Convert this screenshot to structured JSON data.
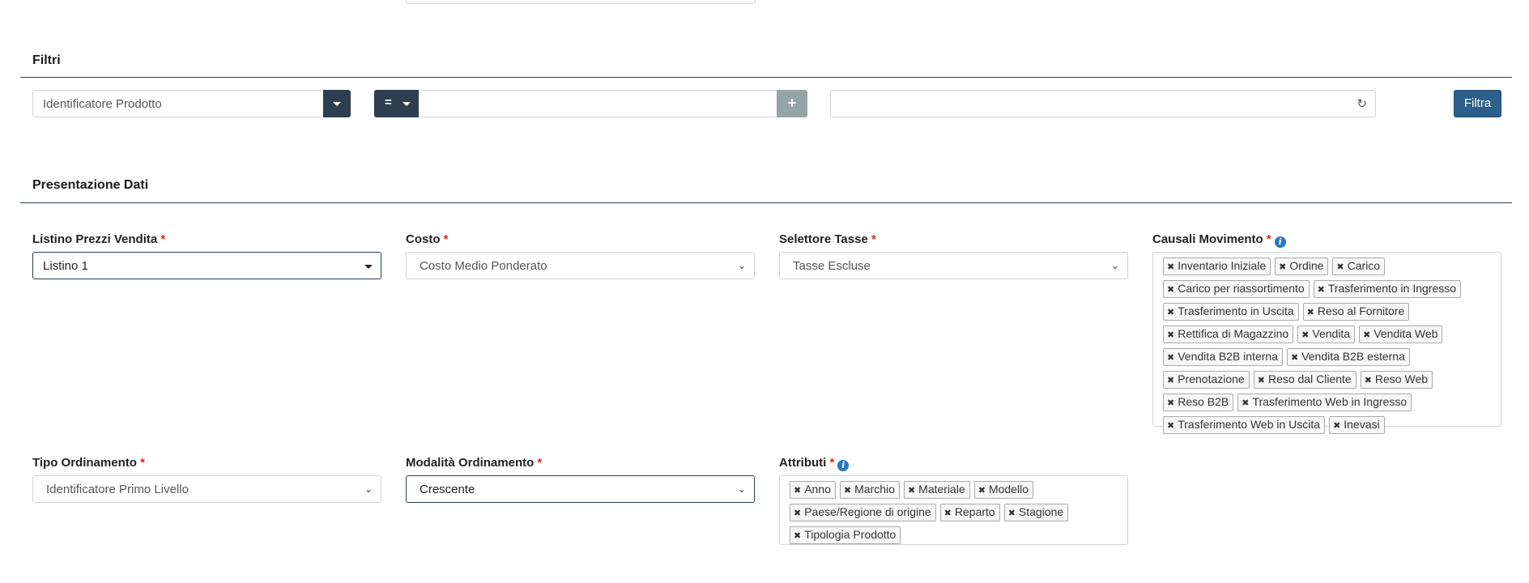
{
  "filters": {
    "title": "Filtri",
    "field_select": "Identificatore Prodotto",
    "operator": "=",
    "value_placeholder": "",
    "plus": "+",
    "refresh_icon": "refresh-icon",
    "filter_button": "Filtra"
  },
  "presentation": {
    "title": "Presentazione Dati",
    "listino": {
      "label": "Listino Prezzi Vendita",
      "value": "Listino 1"
    },
    "costo": {
      "label": "Costo",
      "value": "Costo Medio Ponderato"
    },
    "tasse": {
      "label": "Selettore Tasse",
      "value": "Tasse Escluse"
    },
    "causali": {
      "label": "Causali Movimento",
      "tags": [
        "Inventario Iniziale",
        "Ordine",
        "Carico",
        "Carico per riassortimento",
        "Trasferimento in Ingresso",
        "Trasferimento in Uscita",
        "Reso al Fornitore",
        "Rettifica di Magazzino",
        "Vendita",
        "Vendita Web",
        "Vendita B2B interna",
        "Vendita B2B esterna",
        "Prenotazione",
        "Reso dal Cliente",
        "Reso Web",
        "Reso B2B",
        "Trasferimento Web in Ingresso",
        "Trasferimento Web in Uscita",
        "Inevasi"
      ]
    },
    "tipo": {
      "label": "Tipo Ordinamento",
      "value": "Identificatore Primo Livello"
    },
    "modalita": {
      "label": "Modalità Ordinamento",
      "value": "Crescente"
    },
    "attributi": {
      "label": "Attributi",
      "tags": [
        "Anno",
        "Marchio",
        "Materiale",
        "Modello",
        "Paese/Regione di origine",
        "Reparto",
        "Stagione",
        "Tipologia Prodotto"
      ]
    },
    "required_mark": "*"
  },
  "colors": {
    "primary_dark": "#2c3e50",
    "accent_button": "#2c5f8a",
    "required": "#e0241c",
    "info": "#2a75c8"
  }
}
